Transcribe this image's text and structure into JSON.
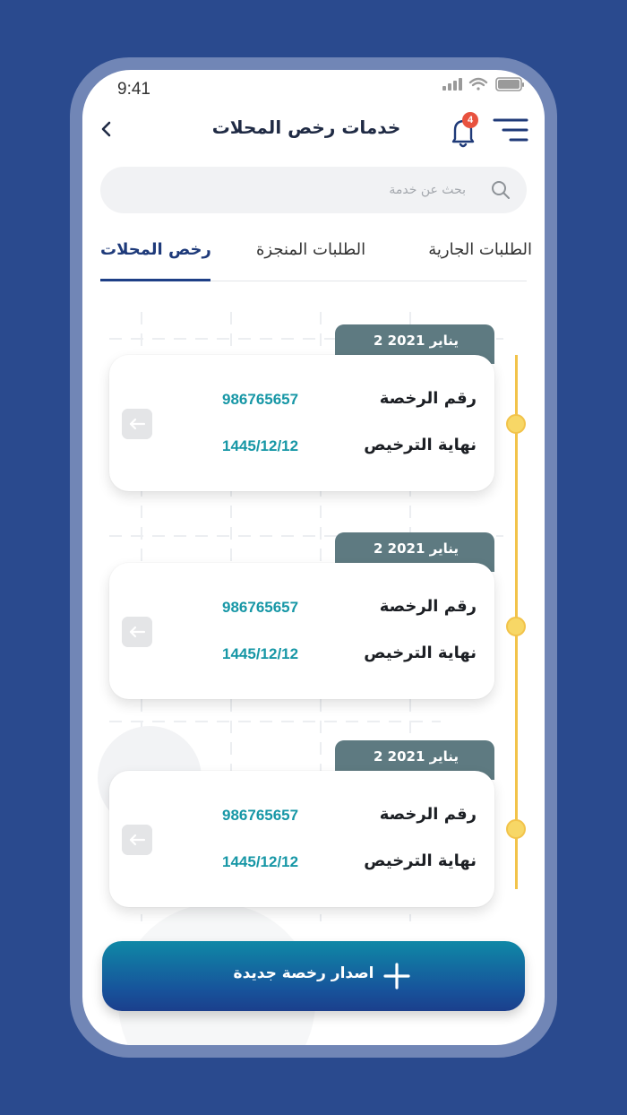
{
  "status_bar": {
    "time": "9:41"
  },
  "header": {
    "title": "خدمات رخص المحلات",
    "notification_count": "4"
  },
  "search": {
    "placeholder": "بحث عن خدمة",
    "value": ""
  },
  "tabs": [
    {
      "label": "الطلبات الجارية",
      "active": false
    },
    {
      "label": "الطلبات المنجزة",
      "active": false
    },
    {
      "label": "رخص المحلات",
      "active": true
    }
  ],
  "licenses": [
    {
      "date": "يناير 2021 2",
      "license_number_label": "رقم الرخصة",
      "license_number": "986765657",
      "expiry_label": "نهاية الترخيص",
      "expiry_date": "1445/12/12"
    },
    {
      "date": "يناير 2021 2",
      "license_number_label": "رقم الرخصة",
      "license_number": "986765657",
      "expiry_label": "نهاية الترخيص",
      "expiry_date": "1445/12/12"
    },
    {
      "date": "يناير 2021 2",
      "license_number_label": "رقم الرخصة",
      "license_number": "986765657",
      "expiry_label": "نهاية الترخيص",
      "expiry_date": "1445/12/12"
    }
  ],
  "actions": {
    "issue_new_license": "اصدار رخصة جديدة"
  },
  "colors": {
    "background": "#2a4a8e",
    "accent": "#1e3a7a",
    "teal_value": "#1797a6",
    "timeline": "#f2c34a",
    "date_tab": "#5e7a81",
    "badge": "#e8523f"
  },
  "icons": {
    "back": "chevron-left-icon",
    "notifications": "bell-icon",
    "menu": "menu-icon",
    "search": "search-icon",
    "card_action": "arrow-left-icon",
    "add": "plus-icon"
  }
}
